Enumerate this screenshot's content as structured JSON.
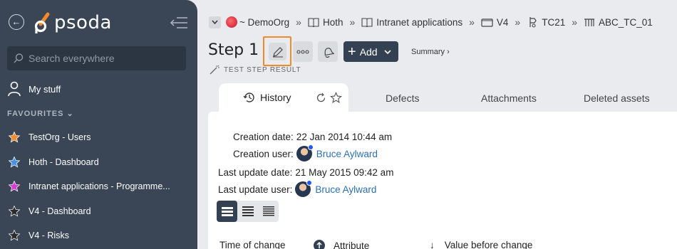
{
  "sidebar": {
    "logo_text": "psoda",
    "search": {
      "placeholder": "Search everywhere",
      "value": ""
    },
    "my_stuff": "My stuff",
    "favourites_heading": "FAVOURITES",
    "favourites": [
      {
        "label": "TestOrg - Users",
        "color": "#f08a2c"
      },
      {
        "label": "Hoth - Dashboard",
        "color": "#4a90e2"
      },
      {
        "label": "Intranet applications - Programme...",
        "color": "#d63ad1"
      },
      {
        "label": "V4 - Dashboard",
        "color": "#2b2b2b"
      },
      {
        "label": "V4 - Risks",
        "color": "#2b2b2b"
      }
    ]
  },
  "breadcrumb": [
    {
      "label": "~ DemoOrg",
      "icon": "org-avatar"
    },
    {
      "label": "Hoth",
      "icon": "book-icon"
    },
    {
      "label": "Intranet applications",
      "icon": "book-icon"
    },
    {
      "label": "V4",
      "icon": "folder-icon"
    },
    {
      "label": "TC21",
      "icon": "test-case-icon"
    },
    {
      "label": "ABC_TC_01",
      "icon": "test-steps-icon"
    }
  ],
  "header": {
    "title": "Step 1",
    "add_label": "Add",
    "summary_label": "Summary ›",
    "subtitle": "TEST STEP RESULT"
  },
  "tabs": [
    "History",
    "Defects",
    "Attachments",
    "Deleted assets"
  ],
  "details": {
    "creation_date_label": "Creation date:",
    "creation_date": "22 Jan 2014 10:44 am",
    "creation_user_label": "Creation user:",
    "creation_user": "Bruce Aylward",
    "last_update_date_label": "Last update date:",
    "last_update_date": "21 May 2015 09:42 am",
    "last_update_user_label": "Last update user:",
    "last_update_user": "Bruce Aylward"
  },
  "table_headers": [
    "Time of change",
    "Attribute",
    "Value before change"
  ],
  "colors": {
    "sidebar": "#3a4555",
    "accent": "#f08a2c",
    "link": "#2d6fb0",
    "primary_button": "#344153"
  }
}
